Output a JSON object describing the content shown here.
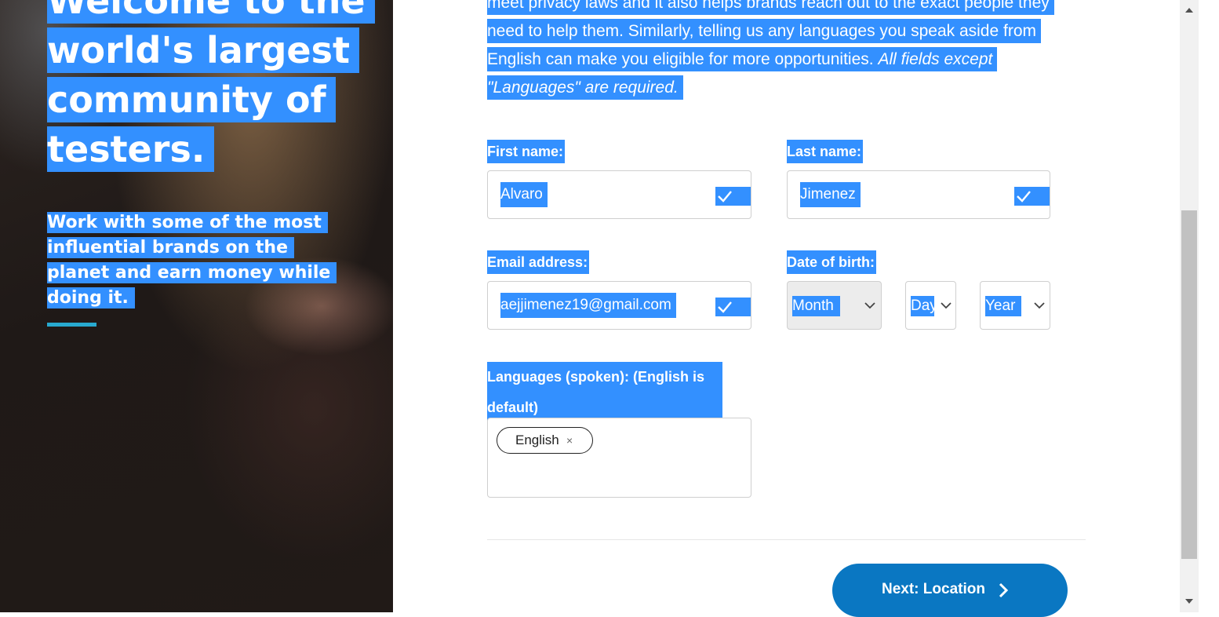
{
  "hero": {
    "title_lines": [
      "Welcome to the",
      "world's largest",
      "community of",
      "testers."
    ],
    "subtitle": "Work with some of the most influential brands on the planet and earn money while doing it."
  },
  "intro": {
    "text": "meet privacy laws and it also helps brands reach out to the exact people they need to help them. Similarly, telling us any languages you speak aside from English can make you eligible for more opportunities.",
    "note": "All fields except \"Languages\" are required."
  },
  "form": {
    "first_name": {
      "label": "First name:",
      "value": "Alvaro"
    },
    "last_name": {
      "label": "Last name:",
      "value": "Jimenez"
    },
    "email": {
      "label": "Email address:",
      "value": "aejjimenez19@gmail.com"
    },
    "dob": {
      "label": "Date of birth:",
      "month": "Month",
      "day": "Day",
      "year": "Year"
    },
    "languages": {
      "label": "Languages (spoken): (English is default)",
      "chips": [
        "English"
      ],
      "remove_glyph": "×"
    },
    "next_button": "Next: Location"
  },
  "colors": {
    "selection": "#3390ff",
    "button": "#0a77c2",
    "accent_bar": "#28a9cf"
  },
  "icons": [
    "check-icon",
    "chevron-down-icon",
    "chevron-right-icon",
    "close-icon",
    "scroll-up-arrow-icon",
    "scroll-down-arrow-icon"
  ]
}
